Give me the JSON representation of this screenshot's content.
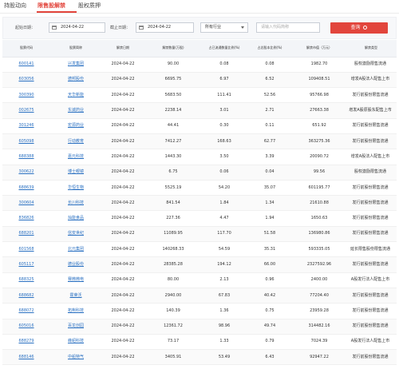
{
  "tabs": [
    {
      "label": "持股动向",
      "active": false
    },
    {
      "label": "限售股解禁",
      "active": true
    },
    {
      "label": "股权质押",
      "active": false
    }
  ],
  "filter": {
    "start_label": "起始日期：",
    "start_value": "2024-04-22",
    "end_label": "截止日期：",
    "end_value": "2024-04-22",
    "industry_value": "所有行业",
    "search_placeholder": "请输入代码简称",
    "query_label": "查询"
  },
  "table": {
    "headers": [
      "股票代码",
      "股票简称",
      "解禁日期",
      "解禁数量(万股)",
      "占已流通数量比例(%)",
      "占总股本比例(%)",
      "解禁市值（万元）",
      "解禁类型"
    ],
    "rows": [
      [
        "600141",
        "兴发集团",
        "2024-04-22",
        "90.00",
        "0.08",
        "0.08",
        "1982.70",
        "股权激励限售流通"
      ],
      [
        "603056",
        "德邦股份",
        "2024-04-22",
        "6695.75",
        "6.97",
        "6.52",
        "109408.51",
        "增发A股法人配售上市"
      ],
      [
        "300390",
        "天华新能",
        "2024-04-22",
        "5683.50",
        "111.41",
        "52.56",
        "95766.98",
        "发行前股份限售流通"
      ],
      [
        "002675",
        "东诚药业",
        "2024-04-22",
        "2238.14",
        "3.01",
        "2.71",
        "27663.38",
        "增发A股原股东配售上市"
      ],
      [
        "301246",
        "宏源药业",
        "2024-04-22",
        "44.41",
        "0.30",
        "0.11",
        "651.92",
        "发行前股份限售流通"
      ],
      [
        "605098",
        "行动教育",
        "2024-04-22",
        "7412.27",
        "168.63",
        "62.77",
        "363275.36",
        "发行前股份限售流通"
      ],
      [
        "688388",
        "嘉元科技",
        "2024-04-22",
        "1443.30",
        "3.50",
        "3.39",
        "20090.72",
        "增发A股法人配售上市"
      ],
      [
        "300622",
        "博士眼镜",
        "2024-04-22",
        "6.75",
        "0.06",
        "0.04",
        "99.56",
        "股权激励限售流通"
      ],
      [
        "688639",
        "华恒生物",
        "2024-04-22",
        "5525.19",
        "54.20",
        "35.07",
        "601195.77",
        "发行前股份限售流通"
      ],
      [
        "300604",
        "长川科技",
        "2024-04-22",
        "841.54",
        "1.84",
        "1.34",
        "21610.88",
        "发行前股份限售流通"
      ],
      [
        "836826",
        "灿能食品",
        "2024-04-22",
        "227.36",
        "4.47",
        "1.94",
        "1650.63",
        "发行前股份限售流通"
      ],
      [
        "688201",
        "信安世纪",
        "2024-04-22",
        "11089.95",
        "117.70",
        "51.58",
        "136980.86",
        "发行前股份限售流通"
      ],
      [
        "601568",
        "北元集团",
        "2024-04-22",
        "140268.33",
        "54.59",
        "35.31",
        "593335.05",
        "延长限售股份限售流通"
      ],
      [
        "605117",
        "德业股份",
        "2024-04-22",
        "28385.28",
        "194.12",
        "66.00",
        "2327592.96",
        "发行前股份限售流通"
      ],
      [
        "688325",
        "赛微微电",
        "2024-04-22",
        "80.00",
        "2.13",
        "0.96",
        "2400.00",
        "A股发行法人配售上市"
      ],
      [
        "688682",
        "霍莱沃",
        "2024-04-22",
        "2940.00",
        "67.83",
        "40.42",
        "77204.40",
        "发行前股份限售流通"
      ],
      [
        "688072",
        "拓荆科技",
        "2024-04-22",
        "140.39",
        "1.36",
        "0.75",
        "23959.28",
        "发行前股份限售流通"
      ],
      [
        "605016",
        "百龙创园",
        "2024-04-22",
        "12361.72",
        "98.96",
        "49.74",
        "314482.16",
        "发行前股份限售流通"
      ],
      [
        "688279",
        "峰岹科技",
        "2024-04-22",
        "73.17",
        "1.33",
        "0.79",
        "7024.39",
        "A股发行法人配售上市"
      ],
      [
        "688146",
        "中船特气",
        "2024-04-22",
        "3405.91",
        "53.49",
        "6.43",
        "92947.22",
        "发行前股份限售流通"
      ]
    ]
  },
  "colors": {
    "accent": "#e2453c",
    "link": "#2b71c2"
  }
}
